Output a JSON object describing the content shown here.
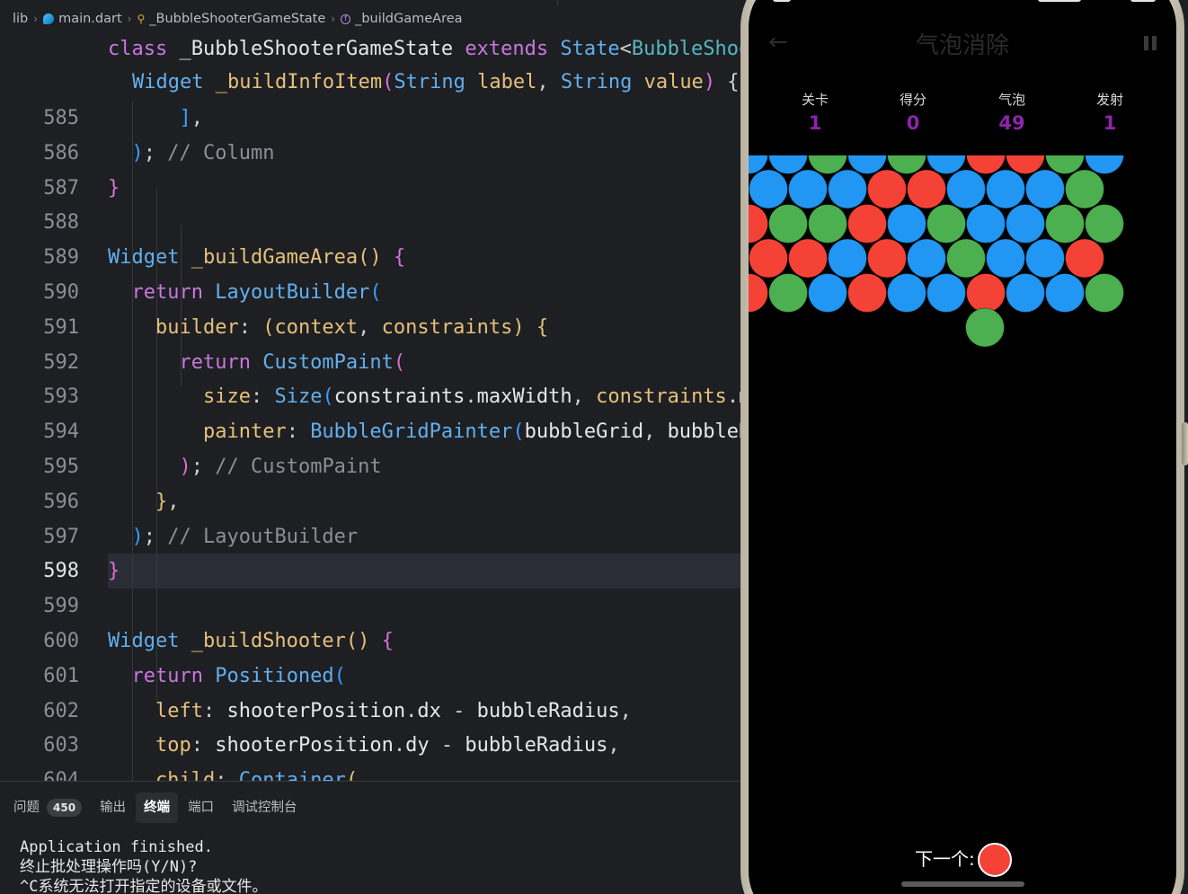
{
  "breadcrumb": {
    "items": [
      "lib",
      "main.dart",
      "_BubbleShooterGameState",
      "_buildGameArea"
    ]
  },
  "sticky": [
    [
      [
        "kw",
        "class "
      ],
      [
        "id",
        "_BubbleShooterGameState "
      ],
      [
        "kw",
        "extends "
      ],
      [
        "ty",
        "State"
      ],
      [
        "pu",
        "<"
      ],
      [
        "tyc",
        "BubbleShooterGame"
      ],
      [
        "pu",
        ">"
      ]
    ],
    [
      [
        "ty",
        "Widget "
      ],
      [
        "fn",
        "_buildInfoItem"
      ],
      [
        "b2",
        "("
      ],
      [
        "ty",
        "String "
      ],
      [
        "pa",
        "label"
      ],
      [
        "pu",
        ", "
      ],
      [
        "ty",
        "String "
      ],
      [
        "pa",
        "value"
      ],
      [
        "b2",
        ")"
      ],
      [
        "pu",
        " {"
      ]
    ]
  ],
  "code": [
    {
      "n": "585",
      "t": [
        [
          "pu",
          "      "
        ],
        [
          "b3",
          "]"
        ],
        [
          "pu",
          ","
        ]
      ]
    },
    {
      "n": "586",
      "t": [
        [
          "pu",
          "  "
        ],
        [
          "b3",
          ")"
        ],
        [
          "pu",
          "; "
        ],
        [
          "cm",
          "// Column"
        ]
      ]
    },
    {
      "n": "587",
      "t": [
        [
          "b2",
          "}"
        ]
      ]
    },
    {
      "n": "588",
      "t": []
    },
    {
      "n": "589",
      "t": [
        [
          "ty",
          "Widget "
        ],
        [
          "fn",
          "_buildGameArea"
        ],
        [
          "b1",
          "()"
        ],
        [
          "pu",
          " "
        ],
        [
          "b2",
          "{"
        ]
      ]
    },
    {
      "n": "590",
      "t": [
        [
          "pu",
          "  "
        ],
        [
          "kw",
          "return "
        ],
        [
          "ty",
          "LayoutBuilder"
        ],
        [
          "b3",
          "("
        ]
      ]
    },
    {
      "n": "591",
      "t": [
        [
          "pu",
          "    "
        ],
        [
          "pr",
          "builder"
        ],
        [
          "pu",
          ": "
        ],
        [
          "b1",
          "("
        ],
        [
          "pa",
          "context"
        ],
        [
          "pu",
          ", "
        ],
        [
          "pa",
          "constraints"
        ],
        [
          "b1",
          ")"
        ],
        [
          "pu",
          " "
        ],
        [
          "b1",
          "{"
        ]
      ]
    },
    {
      "n": "592",
      "t": [
        [
          "pu",
          "      "
        ],
        [
          "kw",
          "return "
        ],
        [
          "ty",
          "CustomPaint"
        ],
        [
          "b2",
          "("
        ]
      ]
    },
    {
      "n": "593",
      "t": [
        [
          "pu",
          "        "
        ],
        [
          "pr",
          "size"
        ],
        [
          "pu",
          ": "
        ],
        [
          "ty",
          "Size"
        ],
        [
          "b3",
          "("
        ],
        [
          "id",
          "constraints"
        ],
        [
          "pu",
          "."
        ],
        [
          "id",
          "maxWidth"
        ],
        [
          "pu",
          ", "
        ],
        [
          "pa",
          "constraints"
        ],
        [
          "pu",
          "."
        ],
        [
          "id",
          "maxHeight"
        ],
        [
          "b3",
          ")"
        ],
        [
          "pu",
          ","
        ]
      ]
    },
    {
      "n": "594",
      "t": [
        [
          "pu",
          "        "
        ],
        [
          "pr",
          "painter"
        ],
        [
          "pu",
          ": "
        ],
        [
          "ty",
          "BubbleGridPainter"
        ],
        [
          "b3",
          "("
        ],
        [
          "id",
          "bubbleGrid"
        ],
        [
          "pu",
          ", "
        ],
        [
          "id",
          "bubbleRadius"
        ],
        [
          "b3",
          ")"
        ],
        [
          "pu",
          ","
        ]
      ]
    },
    {
      "n": "595",
      "t": [
        [
          "pu",
          "      "
        ],
        [
          "b2",
          ")"
        ],
        [
          "pu",
          "; "
        ],
        [
          "cm",
          "// CustomPaint"
        ]
      ]
    },
    {
      "n": "596",
      "t": [
        [
          "pu",
          "    "
        ],
        [
          "b1",
          "}"
        ],
        [
          "pu",
          ","
        ]
      ]
    },
    {
      "n": "597",
      "t": [
        [
          "pu",
          "  "
        ],
        [
          "b3",
          ")"
        ],
        [
          "pu",
          "; "
        ],
        [
          "cm",
          "// LayoutBuilder"
        ]
      ]
    },
    {
      "n": "598",
      "t": [
        [
          "b2",
          "}"
        ]
      ],
      "current": true
    },
    {
      "n": "599",
      "t": []
    },
    {
      "n": "600",
      "t": [
        [
          "ty",
          "Widget "
        ],
        [
          "fn",
          "_buildShooter"
        ],
        [
          "b1",
          "()"
        ],
        [
          "pu",
          " "
        ],
        [
          "b2",
          "{"
        ]
      ]
    },
    {
      "n": "601",
      "t": [
        [
          "pu",
          "  "
        ],
        [
          "kw",
          "return "
        ],
        [
          "ty",
          "Positioned"
        ],
        [
          "b3",
          "("
        ]
      ]
    },
    {
      "n": "602",
      "t": [
        [
          "pu",
          "    "
        ],
        [
          "pr",
          "left"
        ],
        [
          "pu",
          ": "
        ],
        [
          "id",
          "shooterPosition"
        ],
        [
          "pu",
          "."
        ],
        [
          "id",
          "dx"
        ],
        [
          "pu",
          " - "
        ],
        [
          "id",
          "bubbleRadius"
        ],
        [
          "pu",
          ","
        ]
      ]
    },
    {
      "n": "603",
      "t": [
        [
          "pu",
          "    "
        ],
        [
          "pr",
          "top"
        ],
        [
          "pu",
          ": "
        ],
        [
          "id",
          "shooterPosition"
        ],
        [
          "pu",
          "."
        ],
        [
          "id",
          "dy"
        ],
        [
          "pu",
          " - "
        ],
        [
          "id",
          "bubbleRadius"
        ],
        [
          "pu",
          ","
        ]
      ]
    },
    {
      "n": "604",
      "t": [
        [
          "pu",
          "    "
        ],
        [
          "pr",
          "child"
        ],
        [
          "pu",
          ": "
        ],
        [
          "ty",
          "Container"
        ],
        [
          "b1",
          "("
        ]
      ]
    }
  ],
  "panel": {
    "tabs": [
      {
        "label": "问题",
        "badge": "450"
      },
      {
        "label": "输出"
      },
      {
        "label": "终端",
        "active": true
      },
      {
        "label": "端口"
      },
      {
        "label": "调试控制台"
      }
    ],
    "terminal": [
      "Application finished.",
      "终止批处理操作吗(Y/N)?",
      "^C系统无法打开指定的设备或文件。"
    ]
  },
  "phone": {
    "title": "气泡消除",
    "stats": [
      {
        "label": "关卡",
        "value": "1"
      },
      {
        "label": "得分",
        "value": "0"
      },
      {
        "label": "气泡",
        "value": "49"
      },
      {
        "label": "发射",
        "value": "1"
      }
    ],
    "colors": {
      "blue": "#2196f3",
      "red": "#f44336",
      "green": "#4caf50",
      "accent": "#8e24aa"
    },
    "bubble_rows": [
      [
        "blue",
        "blue",
        "green",
        "blue",
        "green",
        "blue",
        "red",
        "red",
        "green",
        "blue"
      ],
      [
        "blue",
        "blue",
        "blue",
        "red",
        "red",
        "blue",
        "blue",
        "blue",
        "green"
      ],
      [
        "red",
        "green",
        "green",
        "red",
        "blue",
        "green",
        "blue",
        "blue",
        "green",
        "green"
      ],
      [
        "red",
        "red",
        "blue",
        "red",
        "blue",
        "green",
        "blue",
        "blue",
        "red"
      ],
      [
        "red",
        "green",
        "blue",
        "red",
        "blue",
        "blue",
        "red",
        "blue",
        "blue",
        "green"
      ],
      [
        "green"
      ]
    ],
    "next_label": "下一个:",
    "next_color": "red"
  }
}
